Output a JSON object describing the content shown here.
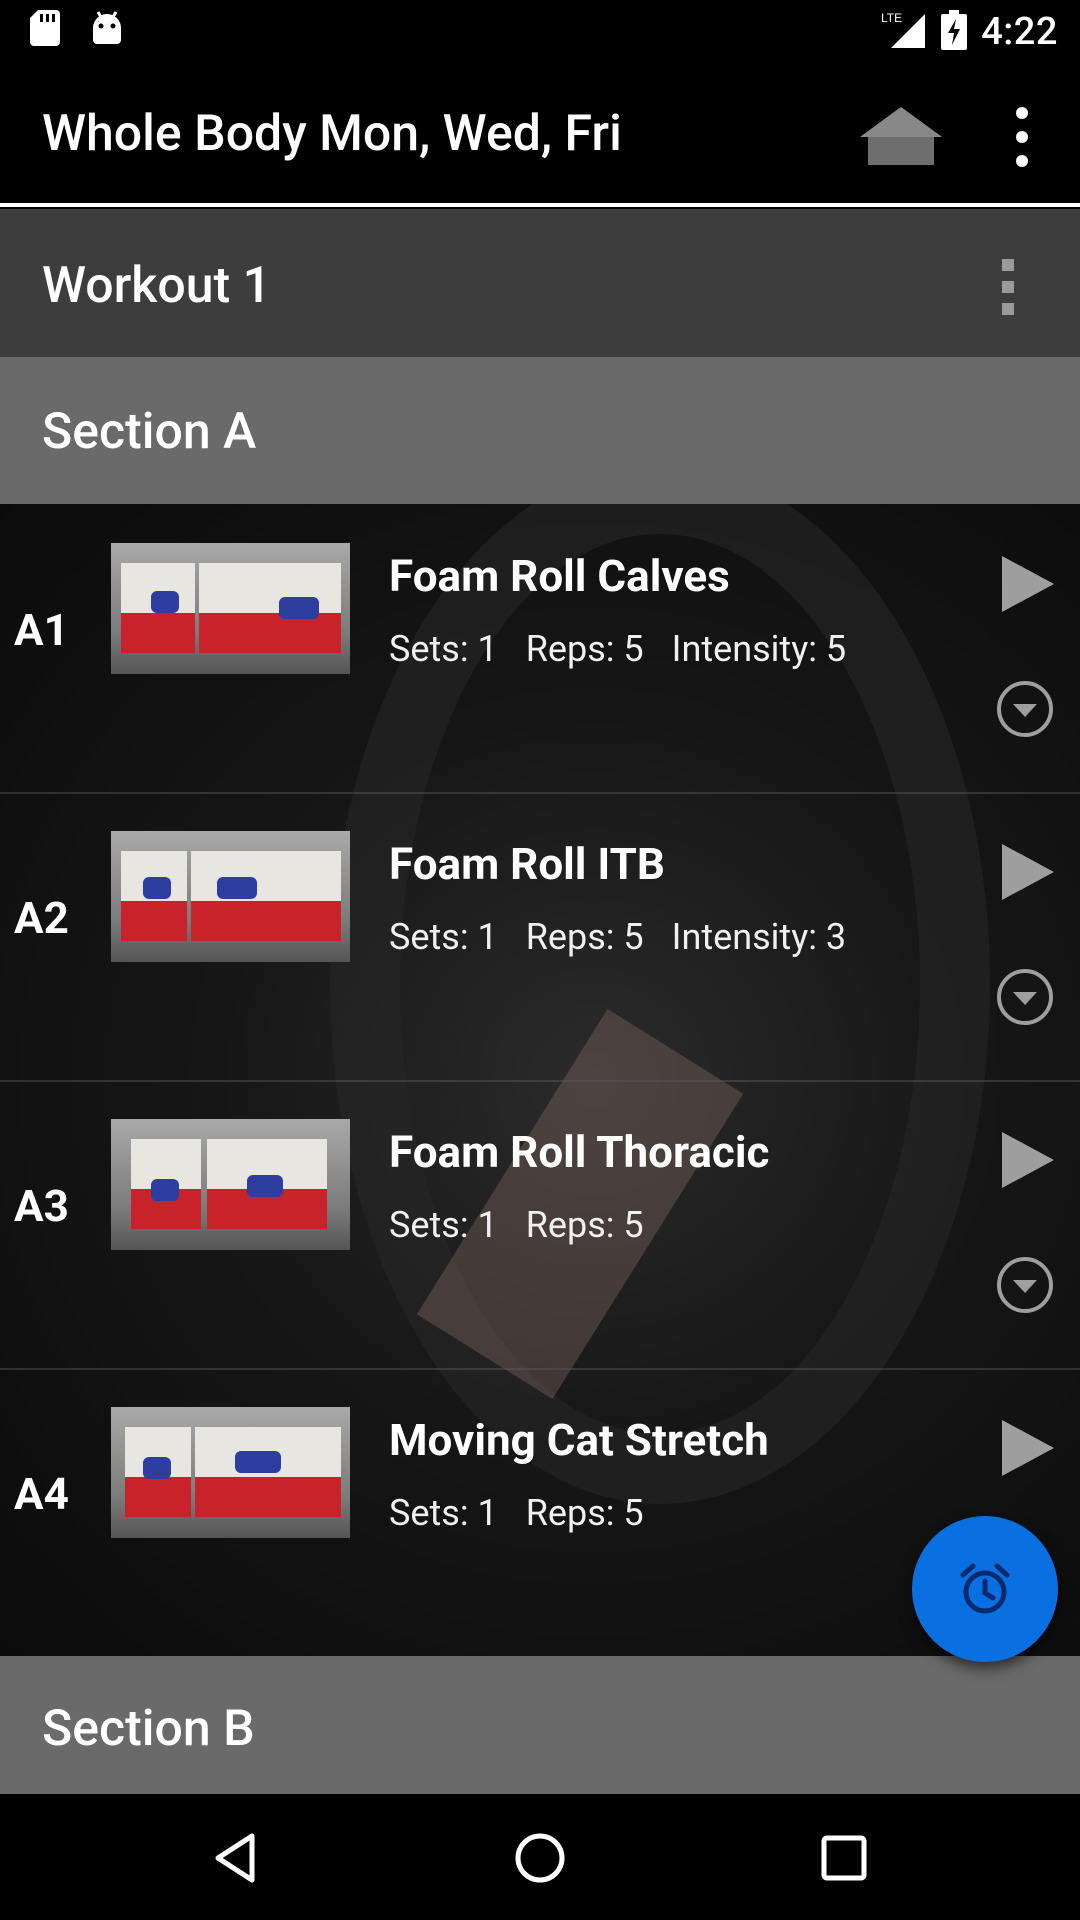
{
  "status_bar": {
    "time": "4:22",
    "network_label": "LTE",
    "icons": [
      "sd-card-icon",
      "android-icon",
      "signal-icon",
      "battery-charging-icon"
    ]
  },
  "app_bar": {
    "title": "Whole Body Mon, Wed, Fri",
    "icons": [
      "home-icon",
      "more-vert-icon"
    ]
  },
  "workout": {
    "title": "Workout 1"
  },
  "sections": [
    {
      "title": "Section A",
      "exercises": [
        {
          "id": "A1",
          "name": "Foam Roll Calves",
          "sets": "Sets: 1",
          "reps": "Reps: 5",
          "intensity": "Intensity: 5"
        },
        {
          "id": "A2",
          "name": "Foam Roll ITB",
          "sets": "Sets: 1",
          "reps": "Reps: 5",
          "intensity": "Intensity: 3"
        },
        {
          "id": "A3",
          "name": "Foam Roll Thoracic",
          "sets": "Sets: 1",
          "reps": "Reps: 5",
          "intensity": ""
        },
        {
          "id": "A4",
          "name": "Moving Cat Stretch",
          "sets": "Sets: 1",
          "reps": "Reps: 5",
          "intensity": ""
        }
      ]
    },
    {
      "title": "Section B",
      "exercises": []
    }
  ],
  "fab": {
    "icon": "alarm-clock-icon"
  },
  "colors": {
    "fab": "#0a6fe0",
    "workout_bar": "#3d3d3d",
    "section_bar": "#6a6a6a"
  },
  "nav_bar": {
    "icons": [
      "back-icon",
      "home-circle-icon",
      "recents-icon"
    ]
  }
}
